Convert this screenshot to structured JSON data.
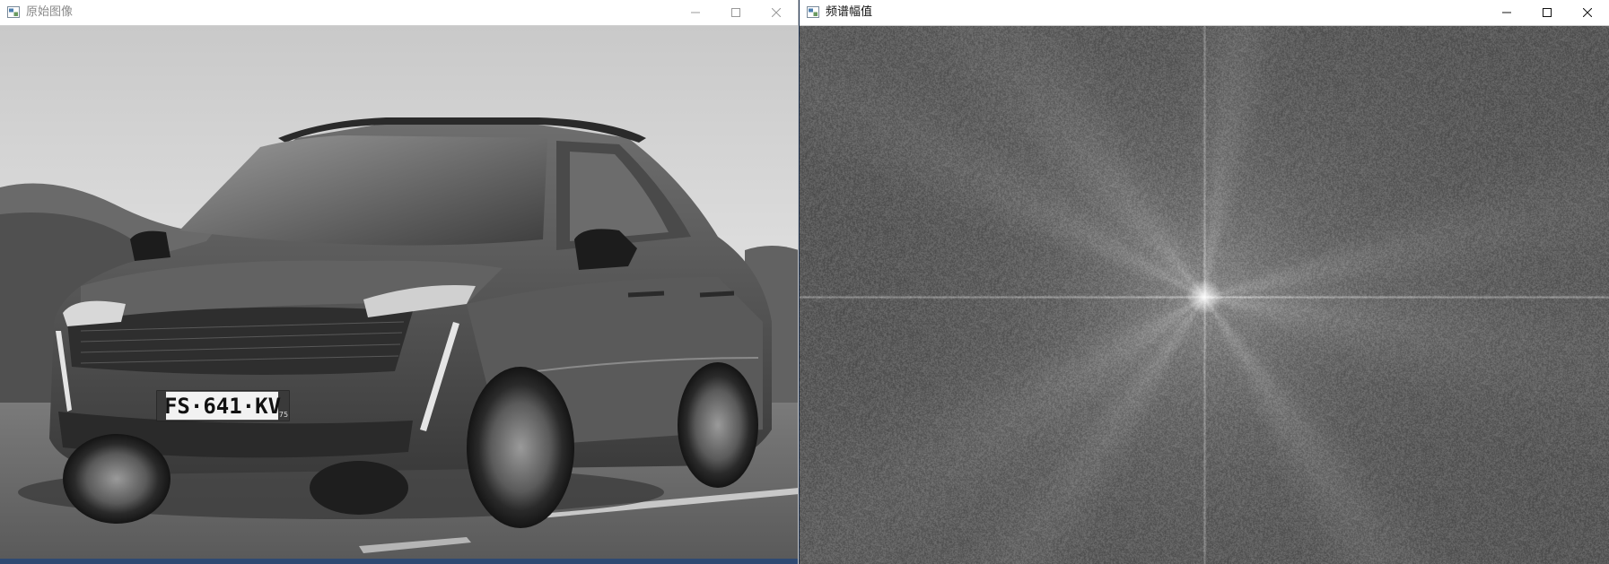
{
  "windows": [
    {
      "id": "original",
      "title": "原始图像",
      "active": false,
      "controls": {
        "minimize": "minimize-icon",
        "maximize": "maximize-icon",
        "close": "close-icon"
      }
    },
    {
      "id": "spectrum",
      "title": "频谱幅值",
      "active": true,
      "controls": {
        "minimize": "minimize-icon",
        "maximize": "maximize-icon",
        "close": "close-icon"
      }
    }
  ],
  "original_image": {
    "subject": "grayscale photo of SUV driving on road",
    "license_plate": "FS·641·KV",
    "plate_region_code": "75"
  },
  "colors": {
    "titlebar": "#ffffff",
    "inactive_title": "#8a8a8a",
    "active_title": "#111111",
    "spectrum_base": "#505050"
  }
}
